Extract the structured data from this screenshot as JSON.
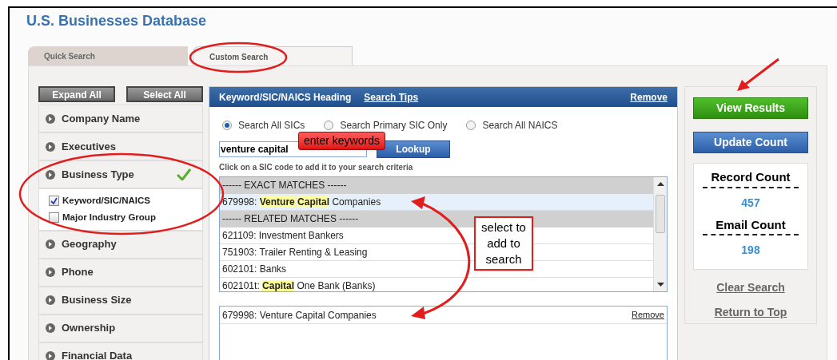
{
  "title": "U.S. Businesses Database",
  "tabs": [
    {
      "label": "Quick Search",
      "selected": false
    },
    {
      "label": "Custom Search",
      "selected": true
    }
  ],
  "left_buttons": [
    "Expand All",
    "Select All"
  ],
  "sections": [
    {
      "label": "Company Name",
      "completed": false,
      "expanded": false
    },
    {
      "label": "Executives",
      "completed": false,
      "expanded": false
    },
    {
      "label": "Business Type",
      "completed": true,
      "expanded": true,
      "options": [
        {
          "label": "Keyword/SIC/NAICS",
          "checked": true
        },
        {
          "label": "Major Industry Group",
          "checked": false
        }
      ]
    },
    {
      "label": "Geography",
      "completed": false,
      "expanded": false
    },
    {
      "label": "Phone",
      "completed": false,
      "expanded": false
    },
    {
      "label": "Business Size",
      "completed": false,
      "expanded": false
    },
    {
      "label": "Ownership",
      "completed": false,
      "expanded": false
    },
    {
      "label": "Financial Data",
      "completed": false,
      "expanded": false
    }
  ],
  "panel": {
    "heading": "Keyword/SIC/NAICS Heading",
    "tips_link": "Search Tips",
    "remove_link": "Remove",
    "radios": [
      {
        "label": "Search All SICs",
        "selected": true
      },
      {
        "label": "Search Primary SIC Only",
        "selected": false
      },
      {
        "label": "Search All NAICS",
        "selected": false
      }
    ],
    "keyword_value": "venture capital",
    "lookup_button": "Lookup",
    "hint": "Click on a SIC code to add it to your search criteria",
    "results": [
      {
        "kind": "header",
        "text": "------ EXACT MATCHES ------"
      },
      {
        "kind": "item",
        "text": "679998: **Venture** **Capital** Companies",
        "selected": true
      },
      {
        "kind": "header",
        "text": "------ RELATED MATCHES ------"
      },
      {
        "kind": "item",
        "text": "621109: Investment Bankers",
        "selected": false
      },
      {
        "kind": "item",
        "text": "751903: Trailer Renting & Leasing",
        "selected": false
      },
      {
        "kind": "item",
        "text": "602101: Banks",
        "selected": false
      },
      {
        "kind": "item",
        "text": "602101t: **Capital** One Bank (Banks)",
        "selected": false
      }
    ],
    "chosen": [
      {
        "text": "679998: Venture Capital Companies",
        "remove": "Remove"
      }
    ]
  },
  "side": {
    "view_button": "View Results",
    "update_button": "Update Count",
    "counts": [
      {
        "label": "Record Count",
        "value": "457"
      },
      {
        "label": "Email Count",
        "value": "198"
      }
    ],
    "links": [
      "Clear Search",
      "Return to Top"
    ]
  },
  "annotations": [
    "enter keywords",
    "select to add to search"
  ]
}
